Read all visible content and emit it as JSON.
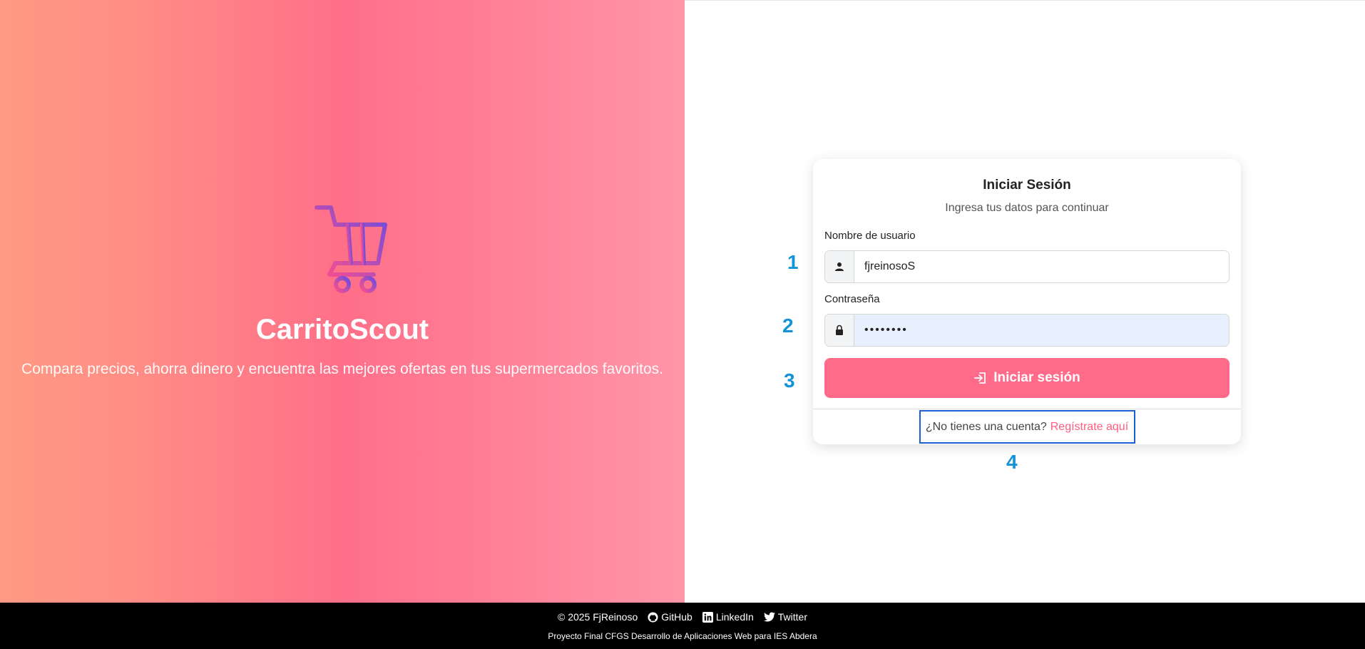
{
  "hero": {
    "brand": "CarritoScout",
    "tagline": "Compara precios, ahorra dinero y encuentra las mejores ofertas en tus supermercados favoritos.",
    "logo_icon": "shopping-cart-icon"
  },
  "login": {
    "title": "Iniciar Sesión",
    "subtitle": "Ingresa tus datos para continuar",
    "username_label": "Nombre de usuario",
    "username_value": "fjreinosoS",
    "password_label": "Contraseña",
    "password_value": "••••••••",
    "submit_label": "Iniciar sesión",
    "no_account_text": "¿No tienes una cuenta?",
    "register_link": "Regístrate aquí"
  },
  "markers": [
    "1",
    "2",
    "3",
    "4"
  ],
  "footer": {
    "copyright": "© 2025 FjReinoso",
    "github": "GitHub",
    "linkedin": "LinkedIn",
    "twitter": "Twitter",
    "project": "Proyecto Final CFGS Desarrollo de Aplicaciones Web para IES Abdera"
  },
  "colors": {
    "accent": "#ff6b89",
    "link": "#ff5c7f",
    "marker": "#1493d8",
    "highlight_border": "#1a5fd6"
  }
}
